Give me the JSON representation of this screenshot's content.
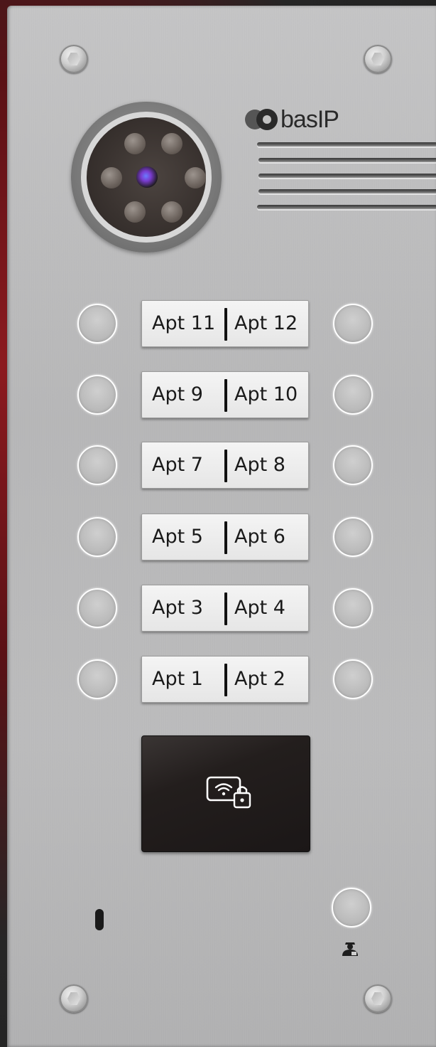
{
  "device": {
    "brand": "basIP",
    "logo_text": "basIP"
  },
  "nameplates": [
    {
      "left": "Apt 11",
      "right": "Apt 12"
    },
    {
      "left": "Apt 9",
      "right": "Apt 10"
    },
    {
      "left": "Apt 7",
      "right": "Apt 8"
    },
    {
      "left": "Apt 5",
      "right": "Apt 6"
    },
    {
      "left": "Apt 3",
      "right": "Apt 4"
    },
    {
      "left": "Apt 1",
      "right": "Apt 2"
    }
  ],
  "icons": {
    "card_reader": "rfid-lock-icon",
    "concierge": "concierge-icon",
    "microphone": "microphone-icon",
    "camera": "camera-icon"
  },
  "colors": {
    "panel": "#bdbdbe",
    "nameplate": "#efefef",
    "card_reader": "#231e1d",
    "button_ring": "#ffffff"
  }
}
